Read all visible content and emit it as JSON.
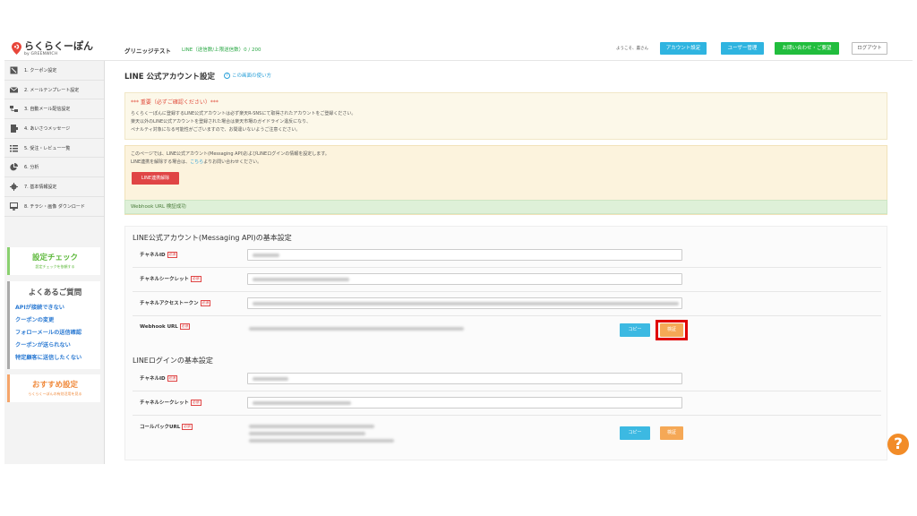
{
  "header": {
    "logo_main": "らくらくーぽん",
    "logo_sub": "by GREENWICH",
    "shop_name": "グリニッジテスト",
    "line_count": "LINE（送信数/上限送信数）0 / 200",
    "welcome": "ようこそ、農さん",
    "account_settings": "アカウント設定",
    "user_management": "ユーザー管理",
    "contact": "お問い合わせ・ご要望",
    "logout": "ログアウト",
    "colors": {
      "accent_blue": "#2fb4e0",
      "accent_green": "#21bd3d"
    }
  },
  "sidebar": {
    "items": [
      {
        "label": "1. クーポン設定",
        "icon": "coupon-icon"
      },
      {
        "label": "2. メールテンプレート設定",
        "icon": "mail-icon"
      },
      {
        "label": "3. 自動メール配信設定",
        "icon": "auto-mail-icon"
      },
      {
        "label": "4. あいさつメッセージ",
        "icon": "greeting-icon"
      },
      {
        "label": "5. 受注・レビュー一覧",
        "icon": "list-icon"
      },
      {
        "label": "6. 分析",
        "icon": "pie-chart-icon"
      },
      {
        "label": "7. 基本情報設定",
        "icon": "gear-icon"
      },
      {
        "label": "8. チラシ・画像 ダウンロード",
        "icon": "download-icon"
      }
    ],
    "check_box": {
      "title": "設定チェック",
      "sub": "設定チェックを依頼する"
    },
    "faq": {
      "title": "よくあるご質問",
      "links": [
        "APIが接続できない",
        "クーポンの変更",
        "フォローメールの送信確認",
        "クーポンが送られない",
        "特定顧客に送信したくない"
      ]
    },
    "recommend": {
      "title": "おすすめ設定",
      "sub": "らくらくーぽんの有効活用を見る"
    }
  },
  "main": {
    "title": "LINE 公式アカウント設定",
    "help_link": "この画面の使い方",
    "notice1": {
      "title": "*** 重要（必ずご確認ください）***",
      "lines": [
        "らくらくーぽんに登録するLINE公式アカウントは必ず楽天R-SNSにて取得されたアカウントをご登録ください。",
        "楽天以外のLINE公式アカウントを登録された場合は楽天市場のガイドライン違反になり、",
        "ペナルティ対象になる可能性がございますので、お間違いないようご注意ください。"
      ]
    },
    "notice2": {
      "line1": "このページでは、LINE公式アカウント(Messaging API)およびLINEログインの情報を設定します。",
      "line2_pre": "LINE連携を解除する場合は、",
      "line2_link": "こちら",
      "line2_post": "よりお問い合わせください。",
      "unlink_button": "LINE連携解除"
    },
    "success_message": "Webhook URL 検証成功",
    "messaging_section": {
      "title": "LINE公式アカウント(Messaging API)の基本設定",
      "rows": [
        {
          "label": "チャネルID",
          "required": "必須"
        },
        {
          "label": "チャネルシークレット",
          "required": "必須"
        },
        {
          "label": "チャネルアクセストークン",
          "required": "必須"
        },
        {
          "label": "Webhook URL",
          "required": "必須"
        }
      ],
      "copy_button": "コピー",
      "verify_button": "検証"
    },
    "login_section": {
      "title": "LINEログインの基本設定",
      "rows": [
        {
          "label": "チャネルID",
          "required": "必須"
        },
        {
          "label": "チャネルシークレット",
          "required": "必須"
        },
        {
          "label": "コールバックURL",
          "required": "必須"
        }
      ],
      "copy_button": "コピー",
      "verify_button": "検証"
    }
  },
  "help_fab": "?"
}
